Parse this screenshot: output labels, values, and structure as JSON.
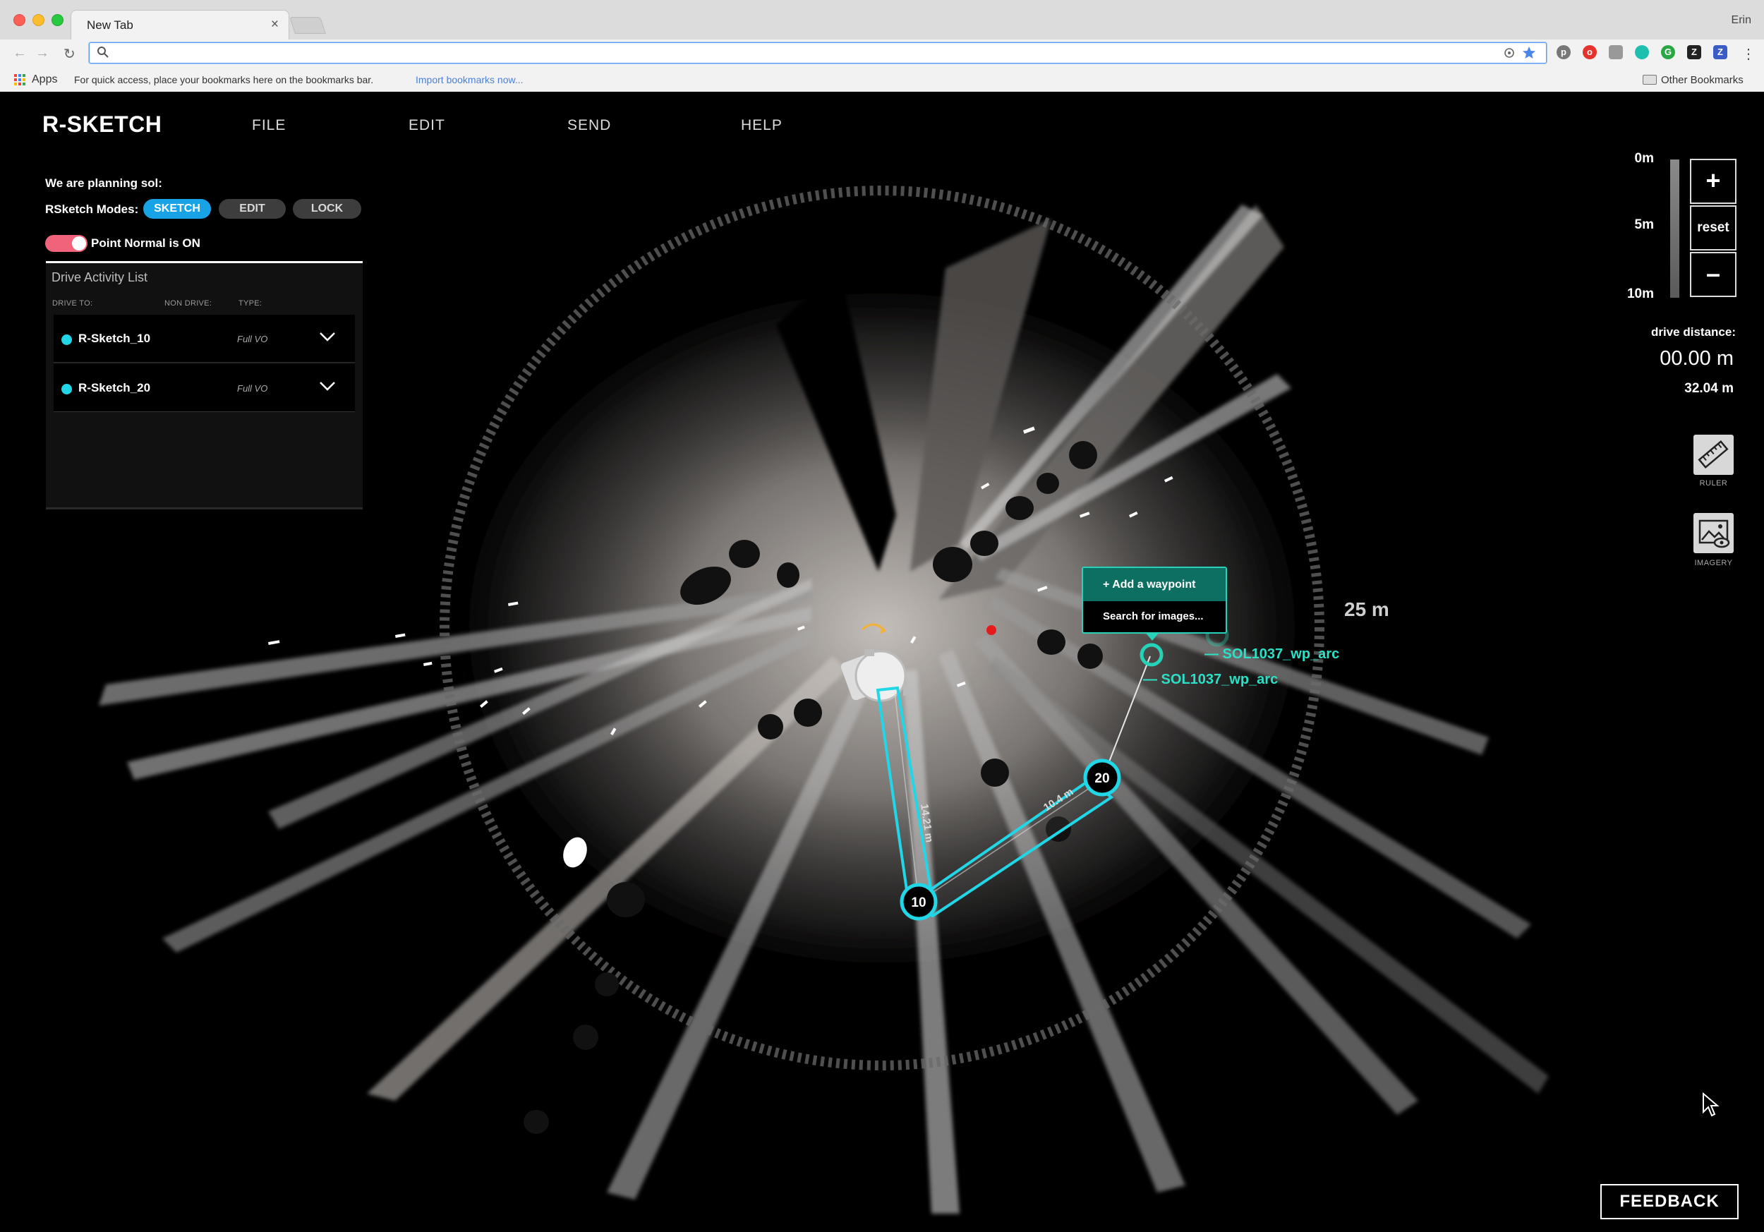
{
  "browser": {
    "tab_title": "New Tab",
    "tab_close": "×",
    "user": "Erin",
    "address_value": "",
    "bookmarks": {
      "apps": "Apps",
      "hint": "For quick access, place your bookmarks here on the bookmarks bar.",
      "import": "Import bookmarks now...",
      "other": "Other Bookmarks"
    }
  },
  "app": {
    "brand": "R-SKETCH",
    "menu": [
      "FILE",
      "EDIT",
      "SEND",
      "HELP"
    ],
    "planning_text": "We are planning sol:",
    "modes_label": "RSketch Modes:",
    "modes": [
      "SKETCH",
      "EDIT",
      "LOCK"
    ],
    "active_mode": "SKETCH",
    "point_normal": {
      "label": "Point Normal is ON",
      "on": true
    }
  },
  "drive_list": {
    "title": "Drive Activity List",
    "headers": [
      "DRIVE TO:",
      "NON DRIVE:",
      "TYPE:"
    ],
    "items": [
      {
        "name": "R-Sketch_10",
        "type": "Full VO"
      },
      {
        "name": "R-Sketch_20",
        "type": "Full VO"
      }
    ]
  },
  "zoom": {
    "scale": [
      "0m",
      "5m",
      "10m"
    ],
    "plus": "+",
    "reset": "reset",
    "minus": "–"
  },
  "drive_distance": {
    "label": "drive distance:",
    "value": "00.00 m",
    "total": "32.04 m"
  },
  "tools": [
    {
      "label": "RULER",
      "icon": "ruler-icon"
    },
    {
      "label": "IMAGERY",
      "icon": "imagery-icon"
    }
  ],
  "map": {
    "range_label": "25 m",
    "waypoints": [
      {
        "label": "10"
      },
      {
        "label": "20"
      }
    ],
    "segments": [
      "14.21 m",
      "10.4 m"
    ],
    "arc_labels": [
      "— SOL1037_wp_arc",
      "— SOL1037_wp_arc"
    ],
    "popup": {
      "add": "+ Add a waypoint",
      "search": "Search for images..."
    }
  },
  "feedback": "FEEDBACK",
  "colors": {
    "accent_blue": "#17a3e6",
    "path_cyan": "#21d6e6",
    "waypoint_green": "#27d3b8",
    "toggle_pink": "#f0637b"
  }
}
